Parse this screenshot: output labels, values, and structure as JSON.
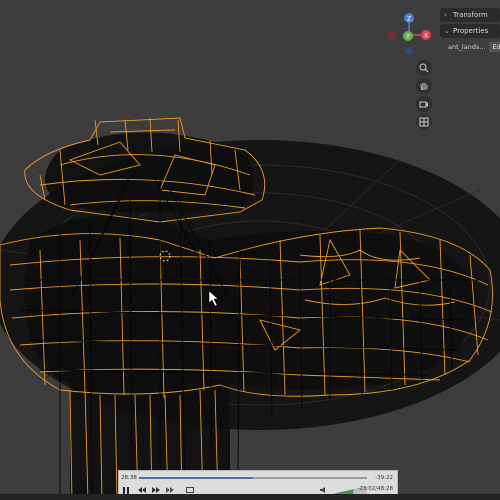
{
  "colors": {
    "background": "#3d3d3d",
    "wireframe": "#e89a2c",
    "ground": "#141414",
    "x_axis": "#e04656",
    "y_axis": "#6ab04c",
    "z_axis": "#4a7fd0"
  },
  "npanel": {
    "transform_label": "Transform",
    "properties_label": "Properties",
    "file_name": "ant_lands...",
    "edit_label": "Edi"
  },
  "gizmo": {
    "x_label": "X",
    "y_label": "Y",
    "z_label": "Z"
  },
  "nav_icons": [
    "zoom-icon",
    "hand-icon",
    "camera-icon",
    "grid-icon"
  ],
  "player": {
    "current_time": "28:38",
    "end_time": "-39:22",
    "total_time": "-23:02/48:28",
    "progress_fraction": 0.5,
    "volume_fraction": 0.6
  }
}
